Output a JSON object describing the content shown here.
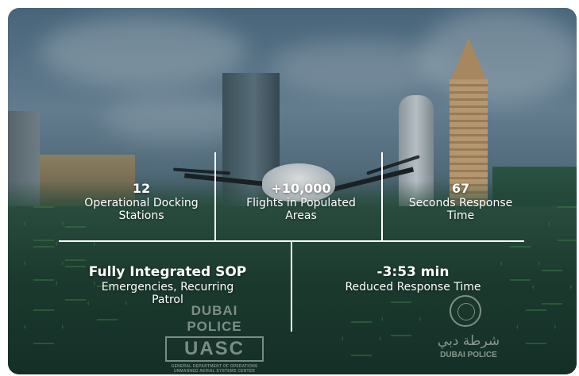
{
  "stats_top": [
    {
      "value": "12",
      "label": "Operational Docking Stations"
    },
    {
      "value": "+10,000",
      "label": "Flights in Populated Areas"
    },
    {
      "value": "67",
      "label": "Seconds Response Time"
    }
  ],
  "stats_bottom": [
    {
      "value": "Fully Integrated SOP",
      "label": "Emergencies, Recurring Patrol"
    },
    {
      "value": "-3:53 min",
      "label": "Reduced Response Time"
    }
  ],
  "logos": {
    "dubai_police": "DUBAI POLICE",
    "uasc": "UASC",
    "uasc_line1": "GENERAL DEPARTMENT OF OPERATIONS",
    "uasc_line2": "UNMANNED AERIAL SYSTEMS CENTER",
    "arabic": "شرطة دبي",
    "dubai_police_small": "DUBAI POLICE"
  },
  "colors": {
    "text": "#ffffff",
    "divider": "#ffffff",
    "panel_green": "#1e3d31"
  }
}
